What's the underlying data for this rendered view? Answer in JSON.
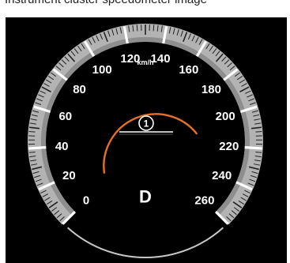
{
  "caption": "Instrument cluster speedometer image",
  "speedometer": {
    "unit": "km/h",
    "min": 0,
    "max": 260,
    "major_step": 20,
    "scale_labels": [
      "0",
      "20",
      "40",
      "60",
      "80",
      "100",
      "120",
      "140",
      "160",
      "180",
      "200",
      "220",
      "240",
      "260"
    ],
    "gear": "D",
    "indicator_number": "1",
    "current_speed": 0,
    "colors": {
      "background": "#000000",
      "bezel_outer": "#b3b3b3",
      "bezel_inner": "#8e8e8e",
      "tick": "#ffffff",
      "label": "#ffffff",
      "speed_arc": "#e8702a",
      "lower_arc": "#c8c8c8"
    }
  }
}
